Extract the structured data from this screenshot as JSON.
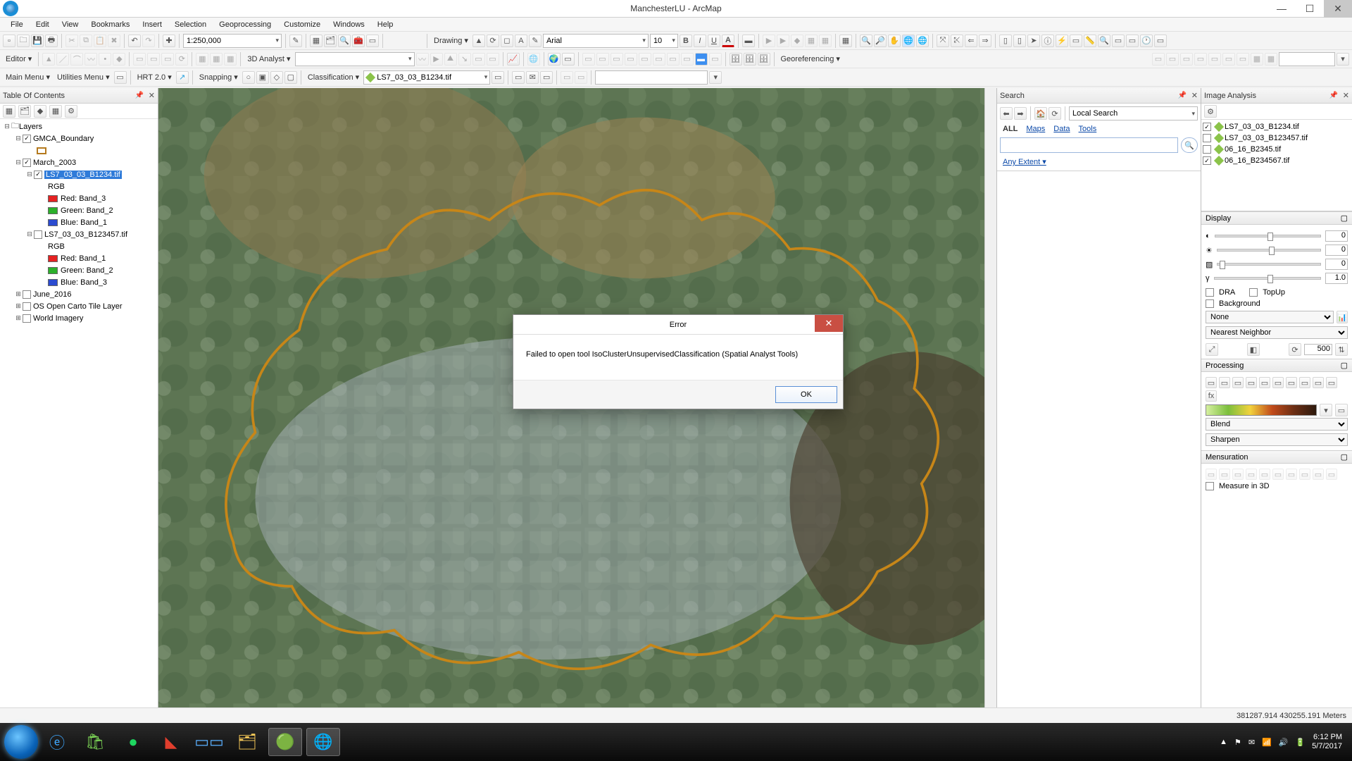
{
  "window": {
    "title": "ManchesterLU - ArcMap"
  },
  "menu": [
    "File",
    "Edit",
    "View",
    "Bookmarks",
    "Insert",
    "Selection",
    "Geoprocessing",
    "Customize",
    "Windows",
    "Help"
  ],
  "row1": {
    "scale": "1:250,000",
    "drawing": "Drawing ▾",
    "font": "Arial",
    "size": "10"
  },
  "row2": {
    "editor": "Editor ▾",
    "analyst3d": "3D Analyst ▾",
    "analyst3d_layer": ""
  },
  "row3": {
    "mainmenu": "Main Menu ▾",
    "utilities": "Utilities Menu ▾",
    "hrt": "HRT 2.0 ▾",
    "snapping": "Snapping ▾",
    "classification": "Classification ▾",
    "class_layer": "LS7_03_03_B1234.tif",
    "georef": "Georeferencing ▾"
  },
  "toc": {
    "title": "Table Of Contents",
    "root": "Layers",
    "items": {
      "gmca": "GMCA_Boundary",
      "march": "March_2003",
      "l1": "LS7_03_03_B1234.tif",
      "l1_sub": "RGB",
      "l1_r": "Red:    Band_3",
      "l1_g": "Green: Band_2",
      "l1_b": "Blue:   Band_1",
      "l2": "LS7_03_03_B123457.tif",
      "l2_sub": "RGB",
      "l2_r": "Red:    Band_1",
      "l2_g": "Green: Band_2",
      "l2_b": "Blue:   Band_3",
      "june": "June_2016",
      "os": "OS Open Carto Tile Layer",
      "world": "World Imagery"
    }
  },
  "search": {
    "title": "Search",
    "local": "Local Search",
    "tabs": {
      "all": "ALL",
      "maps": "Maps",
      "data": "Data",
      "tools": "Tools"
    },
    "extent": "Any Extent ▾"
  },
  "ia": {
    "title": "Image Analysis",
    "layers": [
      "LS7_03_03_B1234.tif",
      "LS7_03_03_B123457.tif",
      "06_16_B2345.tif",
      "06_16_B234567.tif"
    ],
    "display": "Display",
    "sliders": {
      "a": "0",
      "b": "0",
      "c": "0",
      "g": "1.0"
    },
    "dra": "DRA",
    "topup": "TopUp",
    "background": "Background",
    "none": "None",
    "nearest": "Nearest Neighbor",
    "acc": "500",
    "processing": "Processing",
    "blend": "Blend",
    "sharpen": "Sharpen",
    "mensuration": "Mensuration",
    "measure3d": "Measure in 3D"
  },
  "dialog": {
    "title": "Error",
    "msg": "Failed to open tool IsoClusterUnsupervisedClassification (Spatial Analyst Tools)",
    "ok": "OK"
  },
  "status": {
    "coords": "381287.914 430255.191 Meters"
  },
  "taskbar": {
    "time": "6:12 PM",
    "date": "5/7/2017"
  }
}
